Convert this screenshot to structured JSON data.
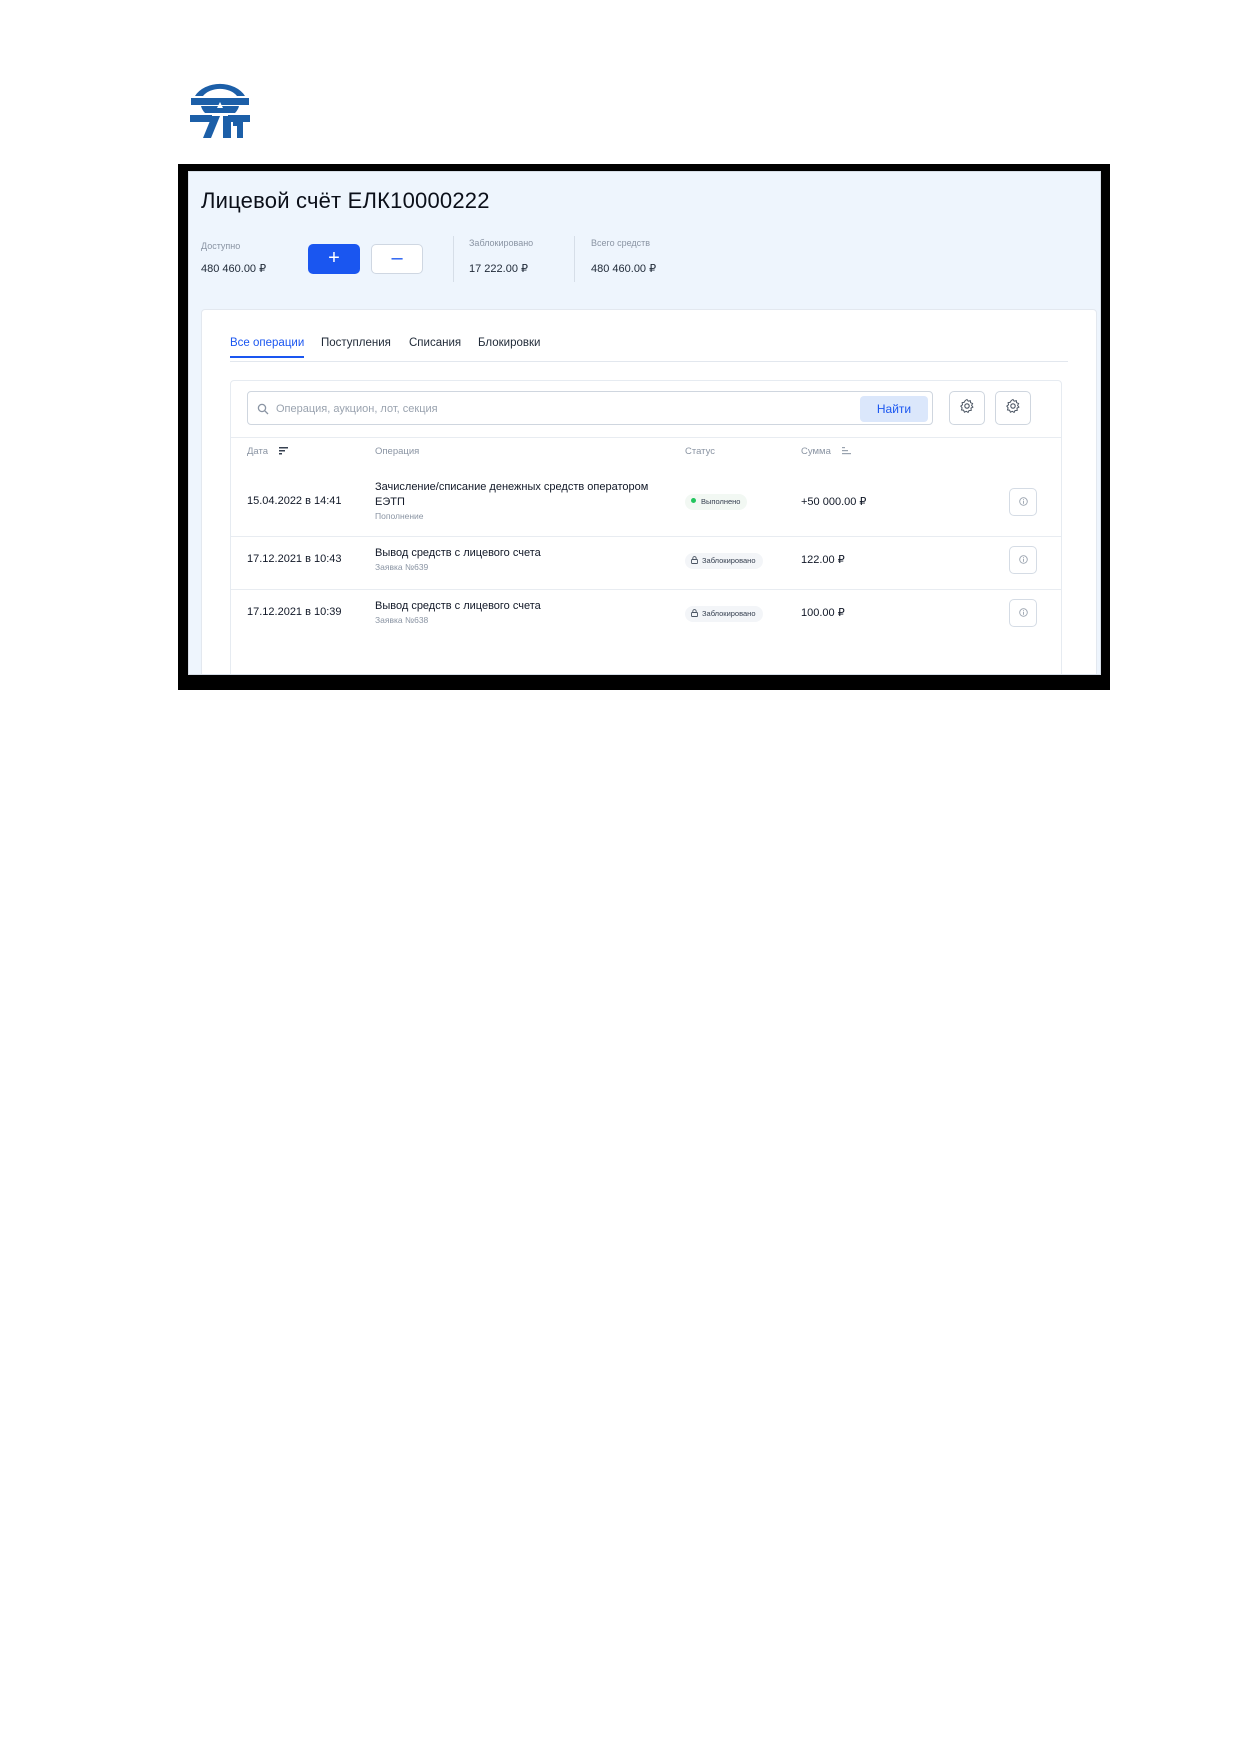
{
  "logo_name": "company-logo",
  "account": {
    "title": "Лицевой счёт ЕЛК10000222",
    "available_label": "Доступно",
    "available_value": "480 460.00 ₽",
    "blocked_label": "Заблокировано",
    "blocked_value": "17 222.00 ₽",
    "total_label": "Всего средств",
    "total_value": "480 460.00 ₽",
    "plus_label": "+",
    "minus_label": "–"
  },
  "tabs": [
    {
      "label": "Все операции",
      "active": true
    },
    {
      "label": "Поступления",
      "active": false
    },
    {
      "label": "Списания",
      "active": false
    },
    {
      "label": "Блокировки",
      "active": false
    }
  ],
  "search": {
    "placeholder": "Операция, аукцион, лот, секция",
    "value": "",
    "button_label": "Найти"
  },
  "table": {
    "headers": {
      "date": "Дата",
      "operation": "Операция",
      "status": "Статус",
      "amount": "Сумма"
    },
    "rows": [
      {
        "date": "15.04.2022 в 14:41",
        "operation_line1": "Зачисление/списание денежных средств оператором",
        "operation_line2": "ЕЭТП",
        "sub": "Пополнение",
        "status": "Выполнено",
        "amount": "+50 000.00 ₽"
      },
      {
        "date": "17.12.2021 в 10:43",
        "operation_line1": "Вывод средств с лицевого счета",
        "operation_line2": "",
        "sub": "Заявка №639",
        "status": "Заблокировано",
        "amount": "122.00 ₽"
      },
      {
        "date": "17.12.2021 в 10:39",
        "operation_line1": "Вывод средств с лицевого счета",
        "operation_line2": "",
        "sub": "Заявка №638",
        "status": "Заблокировано",
        "amount": "100.00 ₽"
      }
    ]
  },
  "colors": {
    "accent": "#1a56f0",
    "success": "#22c55e",
    "logo": "#1c5fa8"
  }
}
